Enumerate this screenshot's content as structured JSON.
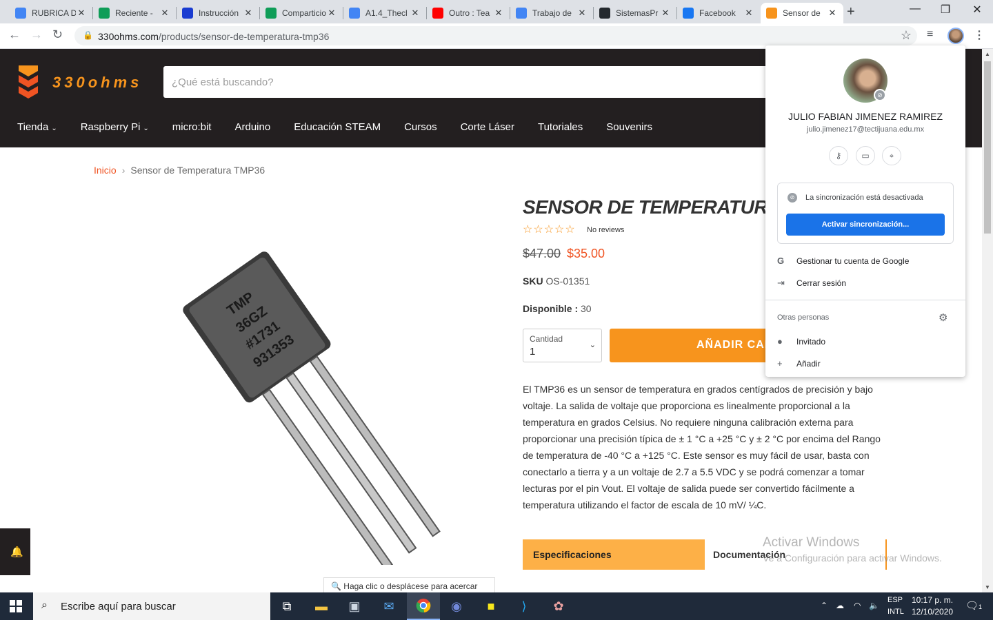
{
  "browser": {
    "tabs": [
      {
        "label": "RUBRICA D",
        "icon": "docs-icon",
        "color": "#4285f4"
      },
      {
        "label": "Reciente -",
        "icon": "drive-icon",
        "color": "#0f9d58"
      },
      {
        "label": "Instrucción",
        "icon": "cp-icon",
        "color": "#1a3cd1"
      },
      {
        "label": "Comparticio",
        "icon": "drive-icon",
        "color": "#0f9d58"
      },
      {
        "label": "A1.4_Thecl",
        "icon": "docs-icon",
        "color": "#4285f4"
      },
      {
        "label": "Outro : Tea",
        "icon": "youtube-icon",
        "color": "#ff0000"
      },
      {
        "label": "Trabajo de",
        "icon": "classroom-icon",
        "color": "#4285f4"
      },
      {
        "label": "SistemasPr",
        "icon": "github-icon",
        "color": "#24292e"
      },
      {
        "label": "Facebook",
        "icon": "facebook-icon",
        "color": "#1877f2"
      },
      {
        "label": "Sensor de",
        "icon": "330ohms-icon",
        "color": "#f7941d",
        "active": true
      }
    ],
    "url_host": "330ohms.com",
    "url_path": "/products/sensor-de-temperatura-tmp36"
  },
  "site": {
    "logo_text": "330ohms",
    "search_placeholder": "¿Qué está buscando?",
    "nav": [
      "Tienda",
      "Raspberry Pi",
      "micro:bit",
      "Arduino",
      "Educación STEAM",
      "Cursos",
      "Corte Láser",
      "Tutoriales",
      "Souvenirs"
    ],
    "brand_color": "#f7941d",
    "accent_color": "#f05423"
  },
  "breadcrumb": {
    "home": "Inicio",
    "current": "Sensor de Temperatura TMP36"
  },
  "product": {
    "title": "SENSOR DE TEMPERATURA",
    "reviews": "No reviews",
    "rating": 0,
    "price_old": "$47.00",
    "price_new": "$35.00",
    "sku_label": "SKU",
    "sku": "OS-01351",
    "avail_label": "Disponible :",
    "avail": "30",
    "qty_label": "Cantidad",
    "qty_value": "1",
    "add_cart": "AÑADIR CAR",
    "description": "El TMP36 es un sensor de temperatura en grados centígrados de precisión y bajo voltaje. La salida de voltaje que proporciona es linealmente proporcional a la temperatura en grados Celsius. No requiere ninguna calibración externa para proporcionar una precisión típica de ± 1 °C a +25 °C y ± 2 °C por encima del Rango de temperatura de -40 °C a +125 °C. Este sensor es muy fácil de usar, basta con conectarlo a tierra y a un voltaje de 2.7 a 5.5 VDC y se podrá comenzar a tomar lecturas por el pin Vout. El voltaje de salida puede ser convertido fácilmente a temperatura utilizando el factor de escala de 10 mV/ ¼C.",
    "tab_spec": "Especificaciones",
    "tab_doc": "Documentación",
    "zoom_hint": "Haga clic o desplácese para acercar",
    "chip_lines": [
      "TMP",
      "36GZ",
      "#1731",
      "931353"
    ]
  },
  "profile": {
    "name": "JULIO FABIAN JIMENEZ RAMIREZ",
    "email": "julio.jimenez17@tectijuana.edu.mx",
    "sync_off": "La sincronización está desactivada",
    "sync_on": "Activar sincronización...",
    "manage": "Gestionar tu cuenta de Google",
    "signout": "Cerrar sesión",
    "others": "Otras personas",
    "guest": "Invitado",
    "add": "Añadir"
  },
  "watermark": {
    "line1": "Activar Windows",
    "line2": "Ve a Configuración para activar Windows."
  },
  "taskbar": {
    "search": "Escribe aquí para buscar",
    "lang1": "ESP",
    "lang2": "INTL",
    "time": "10:17 p. m.",
    "date": "12/10/2020",
    "notif_count": "1"
  }
}
